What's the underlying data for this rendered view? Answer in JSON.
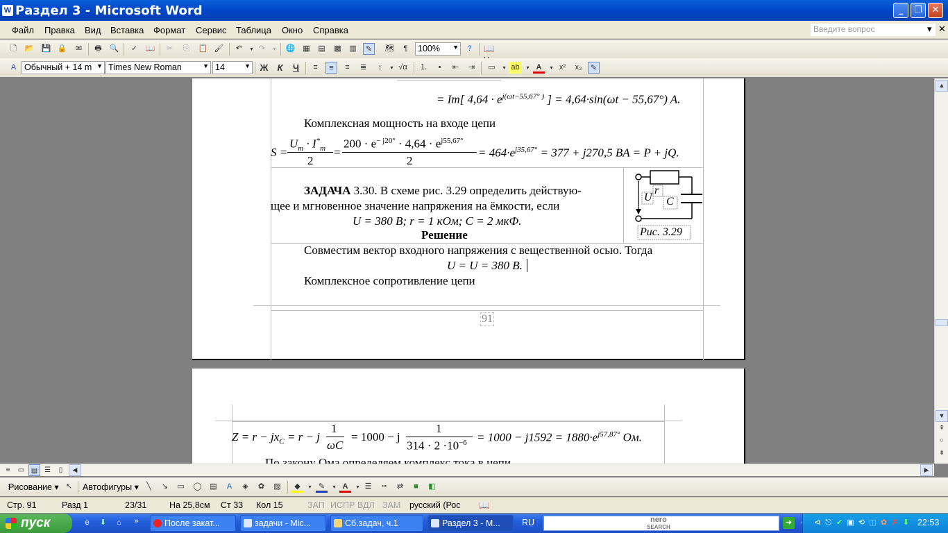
{
  "window": {
    "title": "Раздел 3 - Microsoft Word"
  },
  "menu": {
    "items": [
      "Файл",
      "Правка",
      "Вид",
      "Вставка",
      "Формат",
      "Сервис",
      "Таблица",
      "Окно",
      "Справка"
    ],
    "ask_placeholder": "Введите вопрос"
  },
  "toolbar": {
    "zoom": "100%",
    "reading": "Чтение"
  },
  "format": {
    "style": "Обычный + 14 m",
    "font": "Times New Roman",
    "size": "14"
  },
  "document": {
    "eq_im": "= Im[ 4,64 · e",
    "eq_im_exp": "j(ωt−55,67° )",
    "eq_im_tail": "] = 4,64·sin(ωt − 55,67°) A.",
    "complex_power_heading": "Комплексная мощность на входе цепи",
    "eq_s_left": "S =",
    "eq_s_um": "U",
    "eq_s_um_sub": "m",
    "eq_s_dot": "·",
    "eq_s_im": "I",
    "eq_s_im_sup": "*",
    "eq_s_im_sub": "m",
    "eq_s_den1": "2",
    "eq_s_mid": "=",
    "eq_s_num2": "200 · e",
    "eq_s_num2_exp": "− j20°",
    "eq_s_num2b": "· 4,64 · e",
    "eq_s_num2b_exp": "j55,67°",
    "eq_s_den2": "2",
    "eq_s_right": "= 464·e",
    "eq_s_right_exp": "j35,67°",
    "eq_s_right2": "= 377 + j270,5   BA = P + jQ.",
    "task_label": "ЗАДАЧА",
    "task_text_1": " 3.30. В схеме рис. 3.29 определить действую-",
    "task_text_2": "щее и мгновенное значение напряжения на ёмкости, если",
    "task_given": "U = 380  B;    r = 1 кОм;  C = 2 мкФ.",
    "solution_heading": "Решение",
    "figure_caption": "Рис. 3.29",
    "fig_label_u": "U",
    "fig_label_r": "r",
    "fig_label_c": "C",
    "sol_text_1": "Совместим вектор входного напряжения с вещественной осью. Тогда",
    "sol_text_2": "U = U = 380  B.",
    "sol_text_3": "Комплексное сопротивление цепи",
    "page_number": "91",
    "eq_z_left": "Z = r − jx",
    "eq_z_left_sub": "C",
    "eq_z_mid": "= r − j",
    "eq_z_frac1_num": "1",
    "eq_z_frac1_den": "ωC",
    "eq_z_mid2": "= 1000 − j",
    "eq_z_frac2_num": "1",
    "eq_z_frac2_den": "314 · 2 ·10",
    "eq_z_frac2_den_exp": "−6",
    "eq_z_right": "= 1000 − j1592 = 1880·e",
    "eq_z_right_exp": "j57,87°",
    "eq_z_unit": " Ом.",
    "next_line": "По закону Ома определяем комплекс тока в цепи"
  },
  "drawing": {
    "draw_label": "Рисование",
    "autoshapes_label": "Автофигуры"
  },
  "status": {
    "page": "Стр. 91",
    "section": "Разд 1",
    "pages": "23/31",
    "at": "На 25,8см",
    "line": "Ст 33",
    "col": "Кол 15",
    "rec": "ЗАП",
    "trk": "ИСПР",
    "ext": "ВДЛ",
    "ovr": "ЗАМ",
    "lang": "русский (Рос"
  },
  "taskbar": {
    "start": "пуск",
    "tasks": [
      "После закат...",
      "задачи - Mic...",
      "Сб.задач, ч.1",
      "Раздел 3 - M..."
    ],
    "lang": "RU",
    "search_brand": "nero",
    "search_sub": "SEARCH",
    "clock": "22:53"
  }
}
